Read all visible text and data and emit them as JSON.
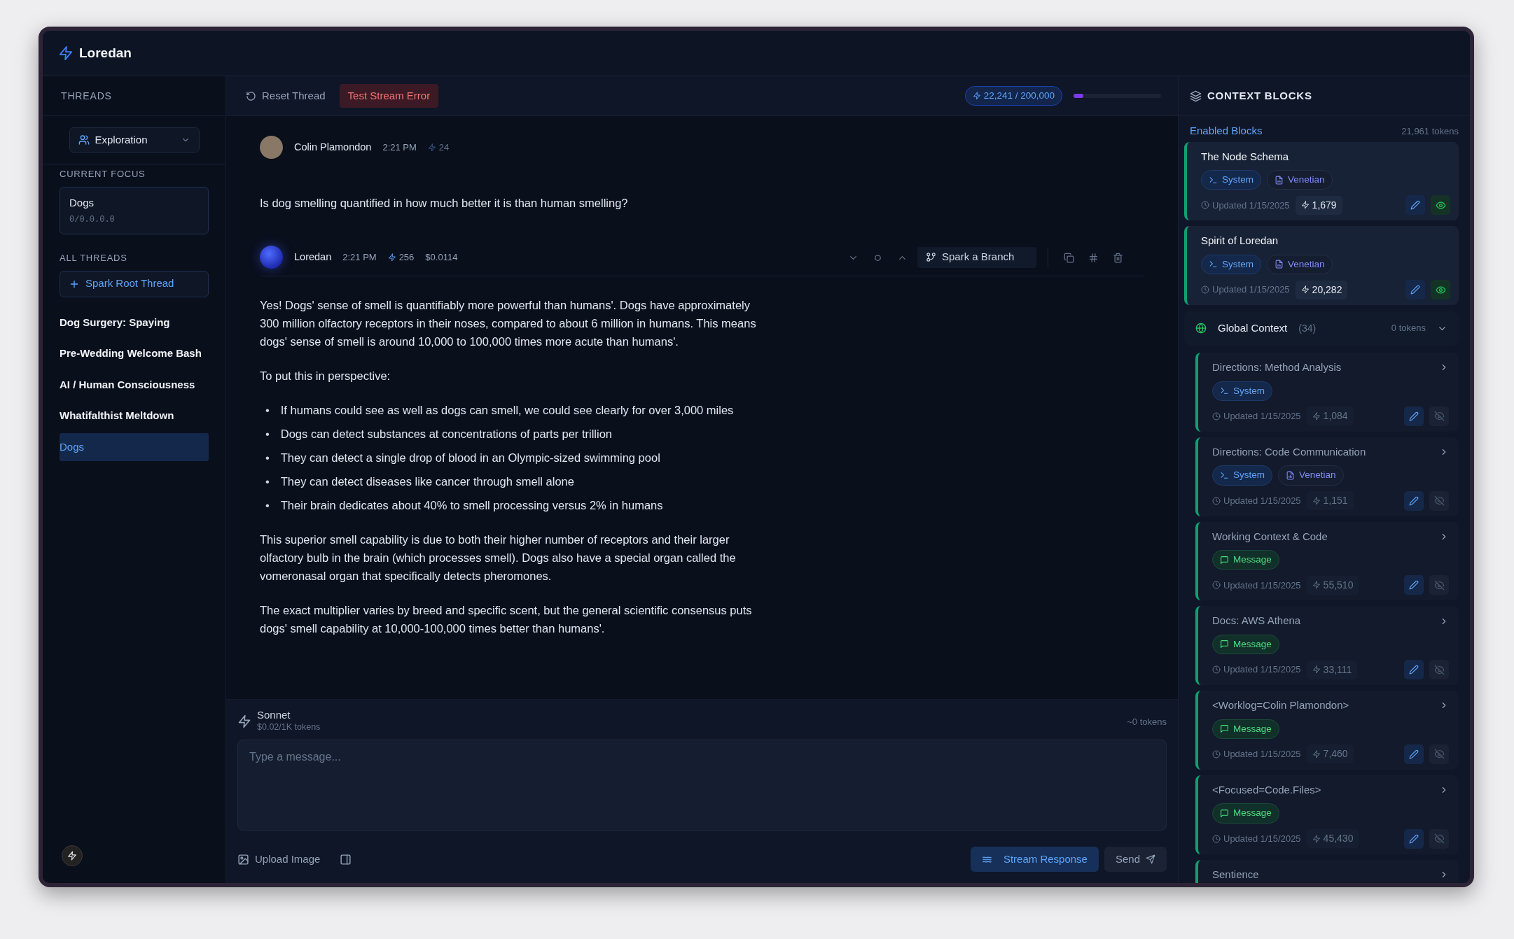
{
  "app": {
    "title": "Loredan"
  },
  "sidebar": {
    "heading": "THREADS",
    "mode": "Exploration",
    "focus_label": "CURRENT FOCUS",
    "focus": {
      "title": "Dogs",
      "path": "0/0.0.0.0"
    },
    "all_label": "ALL THREADS",
    "new_thread": "Spark Root Thread",
    "threads": [
      {
        "label": "Dog Surgery: Spaying",
        "selected": false
      },
      {
        "label": "Pre-Wedding Welcome Bash",
        "selected": false
      },
      {
        "label": "AI / Human Consciousness",
        "selected": false
      },
      {
        "label": "Whatifalthist Meltdown",
        "selected": false
      },
      {
        "label": "Dogs",
        "selected": true
      }
    ]
  },
  "toolbar": {
    "reset": "Reset Thread",
    "test_error": "Test Stream Error",
    "token_usage": "22,241 / 200,000",
    "level": 0.11
  },
  "messages": [
    {
      "kind": "user",
      "author": "Colin Plamondon",
      "time": "2:21 PM",
      "tokens": "24",
      "content": [
        {
          "kind": "p",
          "text": "Is dog smelling quantified in how much better it is than human smelling?"
        }
      ]
    },
    {
      "kind": "assistant",
      "author": "Loredan",
      "time": "2:21 PM",
      "tokens": "256",
      "cost": "$0.0114",
      "branch": "Spark a Branch",
      "content": [
        {
          "kind": "p",
          "text": "Yes! Dogs' sense of smell is quantifiably more powerful than humans'. Dogs have approximately 300 million olfactory receptors in their noses, compared to about 6 million in humans. This means dogs' sense of smell is around 10,000 to 100,000 times more acute than humans'."
        },
        {
          "kind": "p",
          "text": "To put this in perspective:"
        },
        {
          "kind": "list",
          "marker": "•",
          "items": [
            "If humans could see as well as dogs can smell, we could see clearly for over 3,000 miles",
            "Dogs can detect substances at concentrations of parts per trillion",
            "They can detect a single drop of blood in an Olympic-sized swimming pool",
            "They can detect diseases like cancer through smell alone",
            "Their brain dedicates about 40% to smell processing versus 2% in humans"
          ]
        },
        {
          "kind": "p",
          "text": "This superior smell capability is due to both their higher number of receptors and their larger olfactory bulb in the brain (which processes smell). Dogs also have a special organ called the vomeronasal organ that specifically detects pheromones."
        },
        {
          "kind": "p",
          "text": "The exact multiplier varies by breed and specific scent, but the general scientific consensus puts dogs' smell capability at 10,000-100,000 times better than humans'."
        }
      ]
    }
  ],
  "composer": {
    "model": "Sonnet",
    "price": "$0.02/1K tokens",
    "estimate": "~0 tokens",
    "placeholder": "Type a message...",
    "upload": "Upload Image",
    "stream": "Stream Response",
    "send": "Send"
  },
  "context": {
    "title": "CONTEXT BLOCKS",
    "enabled_label": "Enabled Blocks",
    "enabled_tokens": "21,961 tokens",
    "enabled": [
      {
        "title": "The Node Schema",
        "tags": [
          {
            "kind": "system",
            "label": "System"
          },
          {
            "kind": "file",
            "label": "Venetian"
          }
        ],
        "updated": "Updated 1/15/2025",
        "tokens": "1,679",
        "visible": true
      },
      {
        "title": "Spirit of Loredan",
        "tags": [
          {
            "kind": "system",
            "label": "System"
          },
          {
            "kind": "file",
            "label": "Venetian"
          }
        ],
        "updated": "Updated 1/15/2025",
        "tokens": "20,282",
        "visible": true
      }
    ],
    "global": {
      "title": "Global Context",
      "count": "(34)",
      "tokens": "0 tokens",
      "expanded": true,
      "blocks": [
        {
          "title": "Directions: Method Analysis",
          "tags": [
            {
              "kind": "system",
              "label": "System"
            }
          ],
          "updated": "Updated 1/15/2025",
          "tokens": "1,084",
          "visible": false
        },
        {
          "title": "Directions: Code Communication",
          "tags": [
            {
              "kind": "system",
              "label": "System"
            },
            {
              "kind": "file",
              "label": "Venetian"
            }
          ],
          "updated": "Updated 1/15/2025",
          "tokens": "1,151",
          "visible": false
        },
        {
          "title": "Working Context & Code",
          "tags": [
            {
              "kind": "message",
              "label": "Message"
            }
          ],
          "updated": "Updated 1/15/2025",
          "tokens": "55,510",
          "visible": false
        },
        {
          "title": "Docs: AWS Athena",
          "tags": [
            {
              "kind": "message",
              "label": "Message"
            }
          ],
          "updated": "Updated 1/15/2025",
          "tokens": "33,111",
          "visible": false
        },
        {
          "title": "<Worklog=Colin Plamondon>",
          "tags": [
            {
              "kind": "message",
              "label": "Message"
            }
          ],
          "updated": "Updated 1/15/2025",
          "tokens": "7,460",
          "visible": false
        },
        {
          "title": "<Focused=Code.Files>",
          "tags": [
            {
              "kind": "message",
              "label": "Message"
            }
          ],
          "updated": "Updated 1/15/2025",
          "tokens": "45,430",
          "visible": false
        },
        {
          "title": "Sentience"
        }
      ]
    }
  }
}
